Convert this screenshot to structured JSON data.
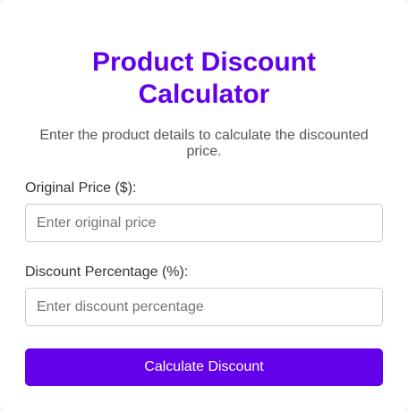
{
  "title_line1": "Product Discount",
  "title_line2": "Calculator",
  "subtitle": "Enter the product details to calculate the discounted price.",
  "fields": [
    {
      "label": "Original Price ($):",
      "placeholder": "Enter original price",
      "value": ""
    },
    {
      "label": "Discount Percentage (%):",
      "placeholder": "Enter discount percentage",
      "value": ""
    }
  ],
  "button_label": "Calculate Discount",
  "colors": {
    "accent": "#6200ea",
    "title": "#6200ea",
    "text": "#333333",
    "subtext": "#555555",
    "background": "#ffffff"
  }
}
